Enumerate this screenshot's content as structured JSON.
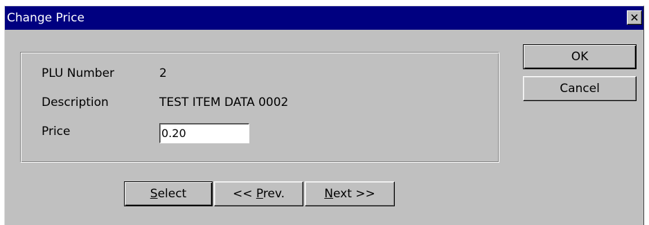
{
  "window": {
    "title": "Change Price",
    "close_glyph": "✕"
  },
  "fields": {
    "plu_label": "PLU Number",
    "plu_value": "2",
    "description_label": "Description",
    "description_value": "TEST ITEM DATA 0002",
    "price_label": "Price",
    "price_value": "0.20"
  },
  "buttons": {
    "ok": "OK",
    "cancel": "Cancel",
    "select": {
      "mnemonic": "S",
      "rest": "elect"
    },
    "prev": {
      "prefix": "<< ",
      "mnemonic": "P",
      "rest": "rev."
    },
    "next": {
      "mnemonic": "N",
      "rest": "ext >>"
    }
  }
}
